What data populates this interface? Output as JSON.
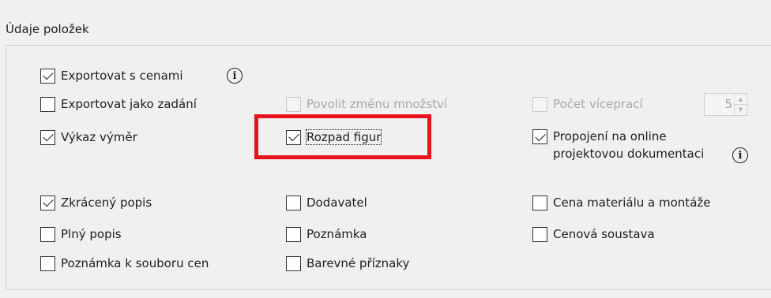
{
  "group": {
    "title": "Údaje položek"
  },
  "options": {
    "export_prices": {
      "label": "Exportovat s cenami",
      "checked": true
    },
    "export_as_tender": {
      "label": "Exportovat jako zadání",
      "checked": false
    },
    "allow_qty_change": {
      "label": "Povolit změnu množství",
      "checked": false,
      "disabled": true
    },
    "count_extra_work": {
      "label": "Počet víceprací",
      "checked": false,
      "disabled": true
    },
    "quantity_statement": {
      "label": "Výkaz výměr",
      "checked": true
    },
    "figure_breakdown": {
      "label": "Rozpad figur",
      "checked": true
    },
    "online_docs_line1": {
      "label": "Propojení na online",
      "checked": true
    },
    "online_docs_line2": {
      "label": "projektovou dokumentaci"
    },
    "short_desc": {
      "label": "Zkrácený popis",
      "checked": true
    },
    "supplier": {
      "label": "Dodavatel",
      "checked": false
    },
    "material_assembly_price": {
      "label": "Cena materiálu a montáže",
      "checked": false
    },
    "full_desc": {
      "label": "Plný popis",
      "checked": false
    },
    "note": {
      "label": "Poznámka",
      "checked": false
    },
    "price_system": {
      "label": "Cenová soustava",
      "checked": false
    },
    "price_file_note": {
      "label": "Poznámka k souboru cen",
      "checked": false
    },
    "color_flags": {
      "label": "Barevné příznaky",
      "checked": false
    }
  },
  "extra_work_spinner": {
    "value": "5"
  },
  "icons": {
    "info": "info-circle-icon",
    "up": "chevron-up-icon",
    "down": "chevron-down-icon"
  },
  "colors": {
    "highlight": "#e8121c"
  }
}
